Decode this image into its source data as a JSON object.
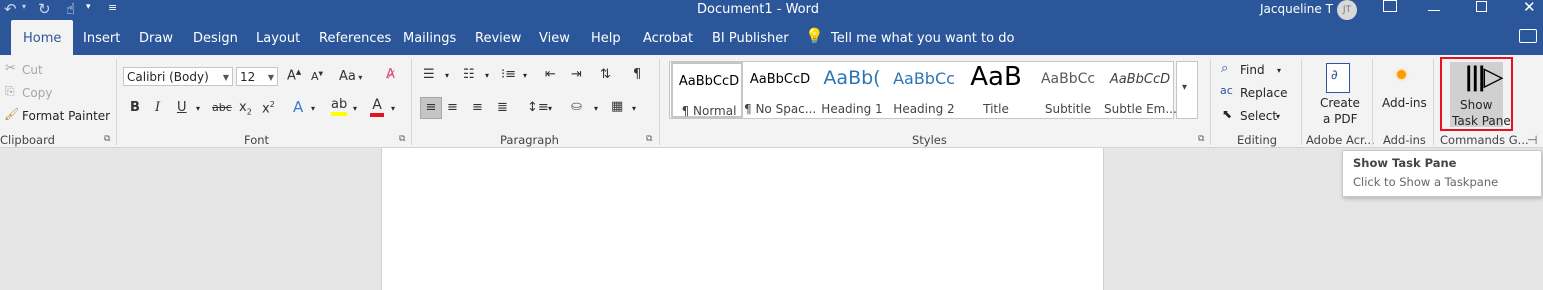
{
  "titlebar": {
    "doc_title": "Document1  -  Word",
    "user_name": "Jacqueline T",
    "user_initials": "JT",
    "qat_undo": "↶",
    "qat_redo": "↻",
    "qat_touch": "☝",
    "qat_customize": "≡"
  },
  "tabs": [
    "Home",
    "Insert",
    "Draw",
    "Design",
    "Layout",
    "References",
    "Mailings",
    "Review",
    "View",
    "Help",
    "Acrobat",
    "BI Publisher"
  ],
  "tell_me": "Tell me what you want to do",
  "clipboard": {
    "cut": "Cut",
    "copy": "Copy",
    "format_painter": "Format Painter",
    "label": "Clipboard"
  },
  "font": {
    "name": "Calibri (Body)",
    "size": "12",
    "label": "Font",
    "change_case": "Aa"
  },
  "paragraph": {
    "label": "Paragraph"
  },
  "styles": {
    "label": "Styles",
    "items": [
      {
        "preview": "AaBbCcD",
        "name": "¶ Normal"
      },
      {
        "preview": "AaBbCcD",
        "name": "¶ No Spac..."
      },
      {
        "preview": "AaBb(",
        "name": "Heading 1"
      },
      {
        "preview": "AaBbCc",
        "name": "Heading 2"
      },
      {
        "preview": "AaB",
        "name": "Title"
      },
      {
        "preview": "AaBbCc",
        "name": "Subtitle"
      },
      {
        "preview": "AaBbCcD",
        "name": "Subtle Em..."
      }
    ]
  },
  "editing": {
    "find": "Find",
    "replace": "Replace",
    "select": "Select",
    "label": "Editing"
  },
  "adobe": {
    "create_line1": "Create",
    "create_line2": "a PDF",
    "label": "Adobe Acr..."
  },
  "addins": {
    "button": "Add-ins",
    "label": "Add-ins"
  },
  "commands": {
    "show_line1": "Show",
    "show_line2": "Task Pane",
    "label": "Commands G..."
  },
  "tooltip": {
    "title": "Show Task Pane",
    "desc": "Click to Show a Taskpane"
  },
  "colors": {
    "accent": "#2b579a",
    "highlight_border": "#e81123",
    "font_color_red": "#e81123",
    "highlight_yellow": "#ffff00"
  }
}
